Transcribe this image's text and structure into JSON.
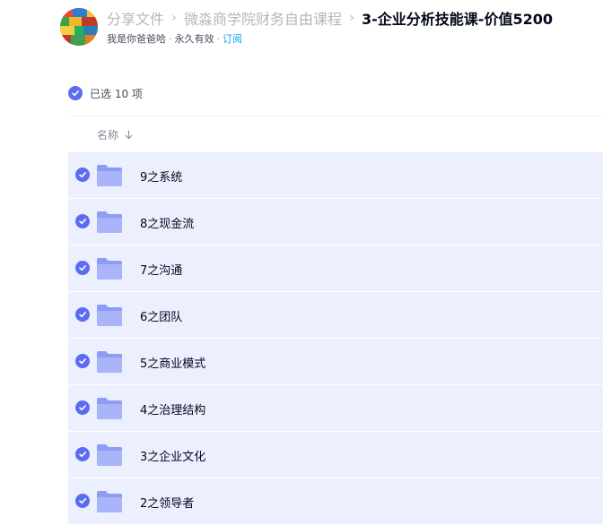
{
  "header": {
    "breadcrumbs": [
      "分享文件",
      "微淼商学院财务自由课程"
    ],
    "current_title": "3-企业分析技能课-价值5200",
    "separator_icon": "chevron-right-icon",
    "sharer": "我是你爸爸哈",
    "validity": "永久有效",
    "subscribe_label": "订阅",
    "subscribe_color": "#06a7ff"
  },
  "selection": {
    "label": "已选 10 项",
    "check_color": "#5b6cf0"
  },
  "columns": {
    "name_label": "名称",
    "sort_icon": "arrow-down-icon"
  },
  "files": [
    {
      "name": "9之系统",
      "type": "folder",
      "selected": true
    },
    {
      "name": "8之现金流",
      "type": "folder",
      "selected": true
    },
    {
      "name": "7之沟通",
      "type": "folder",
      "selected": true
    },
    {
      "name": "6之团队",
      "type": "folder",
      "selected": true
    },
    {
      "name": "5之商业模式",
      "type": "folder",
      "selected": true
    },
    {
      "name": "4之治理结构",
      "type": "folder",
      "selected": true
    },
    {
      "name": "3之企业文化",
      "type": "folder",
      "selected": true
    },
    {
      "name": "2之领导者",
      "type": "folder",
      "selected": true
    }
  ],
  "colors": {
    "row_selected_bg": "#eceffe",
    "folder": "#8c9cf5"
  }
}
